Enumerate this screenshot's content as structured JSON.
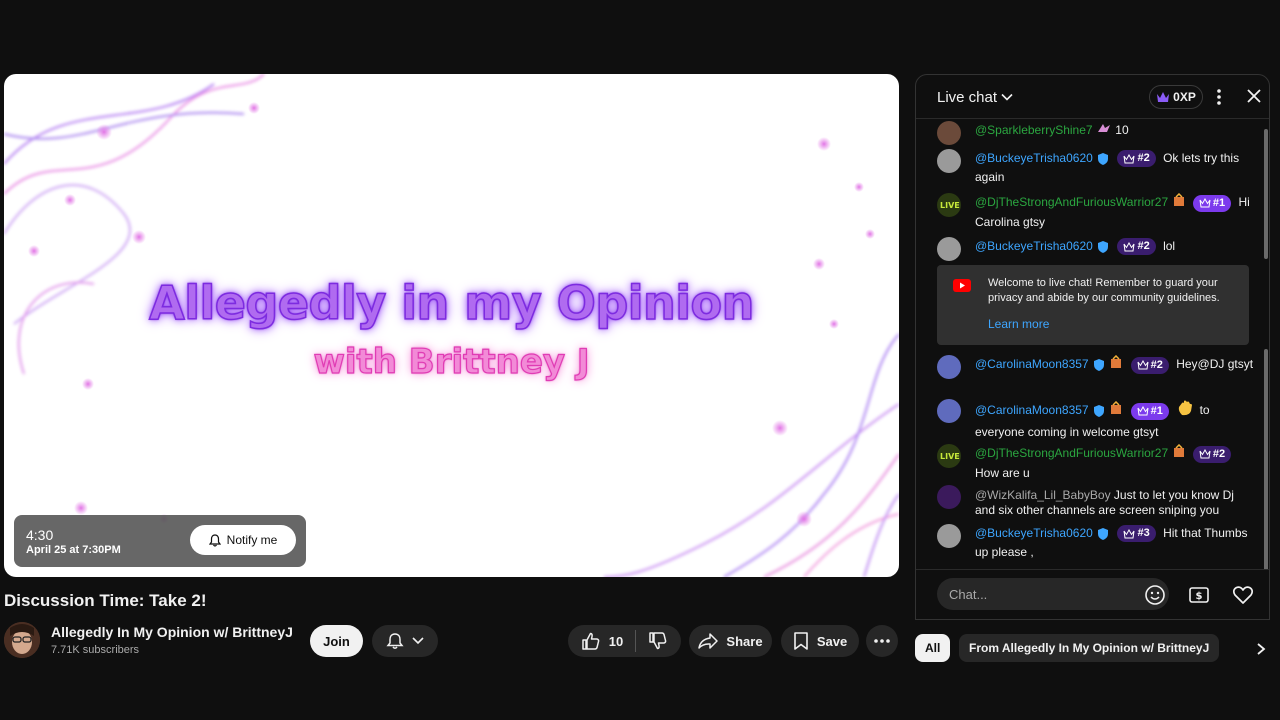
{
  "player": {
    "title_line1": "Allegedly in my Opinion",
    "title_line2": "with Brittney J",
    "countdown": "4:30",
    "schedule_date": "April 25 at 7:30PM",
    "notify_label": "Notify me"
  },
  "video": {
    "title": "Discussion Time: Take 2!",
    "channel_name": "Allegedly In My Opinion w/ BrittneyJ",
    "subscribers": "7.71K subscribers",
    "join_label": "Join",
    "like_count": "10",
    "share_label": "Share",
    "save_label": "Save"
  },
  "chat": {
    "title": "Live chat",
    "xp": "0XP",
    "messages": [
      {
        "author": "@SparkleberryShine7",
        "text": "10"
      },
      {
        "author": "@BuckeyeTrisha0620",
        "rank": "#2",
        "text": "Ok lets try this again"
      },
      {
        "author": "@DjTheStrongAndFuriousWarrior27",
        "rank": "#1",
        "text": "Hi Carolina gtsy"
      },
      {
        "author": "@BuckeyeTrisha0620",
        "rank": "#2",
        "text": "lol"
      },
      {
        "author": "@CarolinaMoon8357",
        "rank": "#2",
        "text": "Hey@DJ gtsyt"
      },
      {
        "author": "@CarolinaMoon8357",
        "rank": "#1",
        "text": "to everyone coming in welcome gtsyt"
      },
      {
        "author": "@DjTheStrongAndFuriousWarrior27",
        "rank": "#2",
        "text": "How are u"
      },
      {
        "author": "@WizKalifa_Lil_BabyBoy",
        "text": "Just to let you know Dj and six other channels are screen sniping you"
      },
      {
        "author": "@BuckeyeTrisha0620",
        "rank": "#3",
        "text": "Hit that Thumbs up please ,"
      }
    ],
    "welcome_text": "Welcome to live chat! Remember to guard your privacy and abide by our community guidelines.",
    "learn_more": "Learn more",
    "input_placeholder": "Chat...",
    "filter_all": "All",
    "filter_from": "From Allegedly In My Opinion w/ BrittneyJ"
  },
  "colors": {
    "accent_blue": "#3ea6ff",
    "member_green": "#2ba640",
    "badge_purple": "#7c3aed"
  }
}
